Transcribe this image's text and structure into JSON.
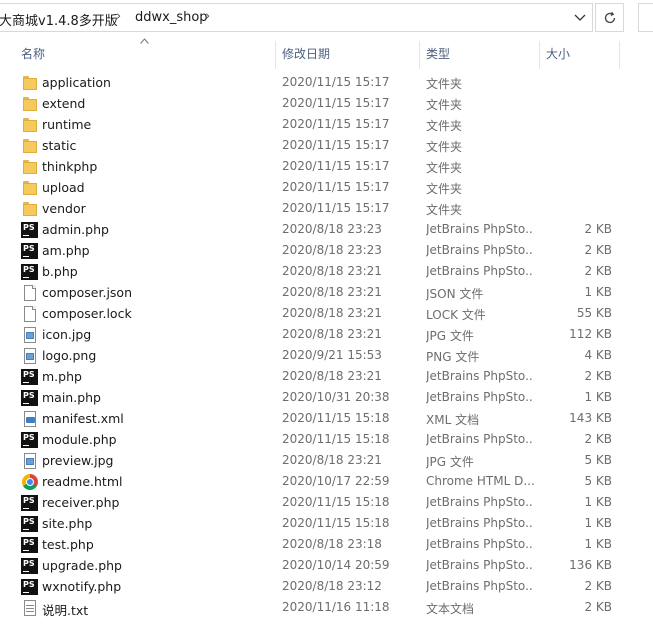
{
  "address_bar": {
    "crumbs": [
      "大商城v1.4.8多开版",
      "ddwx_shop"
    ],
    "separator": "›",
    "dropdown_icon": "chevron-down-icon",
    "refresh_icon": "refresh-icon"
  },
  "columns": {
    "name": "名称",
    "date": "修改日期",
    "type": "类型",
    "size": "大小"
  },
  "files": [
    {
      "name": "application",
      "date": "2020/11/15 15:17",
      "type": "文件夹",
      "size": "",
      "icon": "folder-icon"
    },
    {
      "name": "extend",
      "date": "2020/11/15 15:17",
      "type": "文件夹",
      "size": "",
      "icon": "folder-icon"
    },
    {
      "name": "runtime",
      "date": "2020/11/15 15:17",
      "type": "文件夹",
      "size": "",
      "icon": "folder-icon"
    },
    {
      "name": "static",
      "date": "2020/11/15 15:17",
      "type": "文件夹",
      "size": "",
      "icon": "folder-icon"
    },
    {
      "name": "thinkphp",
      "date": "2020/11/15 15:17",
      "type": "文件夹",
      "size": "",
      "icon": "folder-icon"
    },
    {
      "name": "upload",
      "date": "2020/11/15 15:17",
      "type": "文件夹",
      "size": "",
      "icon": "folder-icon"
    },
    {
      "name": "vendor",
      "date": "2020/11/15 15:17",
      "type": "文件夹",
      "size": "",
      "icon": "folder-icon"
    },
    {
      "name": "admin.php",
      "date": "2020/8/18 23:23",
      "type": "JetBrains PhpSto...",
      "size": "2 KB",
      "icon": "phpstorm-icon"
    },
    {
      "name": "am.php",
      "date": "2020/8/18 23:23",
      "type": "JetBrains PhpSto...",
      "size": "2 KB",
      "icon": "phpstorm-icon"
    },
    {
      "name": "b.php",
      "date": "2020/8/18 23:21",
      "type": "JetBrains PhpSto...",
      "size": "2 KB",
      "icon": "phpstorm-icon"
    },
    {
      "name": "composer.json",
      "date": "2020/8/18 23:21",
      "type": "JSON 文件",
      "size": "1 KB",
      "icon": "document-icon"
    },
    {
      "name": "composer.lock",
      "date": "2020/8/18 23:21",
      "type": "LOCK 文件",
      "size": "55 KB",
      "icon": "document-icon"
    },
    {
      "name": "icon.jpg",
      "date": "2020/8/18 23:21",
      "type": "JPG 文件",
      "size": "112 KB",
      "icon": "image-icon"
    },
    {
      "name": "logo.png",
      "date": "2020/9/21 15:53",
      "type": "PNG 文件",
      "size": "4 KB",
      "icon": "image-icon"
    },
    {
      "name": "m.php",
      "date": "2020/8/18 23:21",
      "type": "JetBrains PhpSto...",
      "size": "2 KB",
      "icon": "phpstorm-icon"
    },
    {
      "name": "main.php",
      "date": "2020/10/31 20:38",
      "type": "JetBrains PhpSto...",
      "size": "1 KB",
      "icon": "phpstorm-icon"
    },
    {
      "name": "manifest.xml",
      "date": "2020/11/15 15:18",
      "type": "XML 文档",
      "size": "143 KB",
      "icon": "xml-icon"
    },
    {
      "name": "module.php",
      "date": "2020/11/15 15:18",
      "type": "JetBrains PhpSto...",
      "size": "2 KB",
      "icon": "phpstorm-icon"
    },
    {
      "name": "preview.jpg",
      "date": "2020/8/18 23:21",
      "type": "JPG 文件",
      "size": "5 KB",
      "icon": "image-icon"
    },
    {
      "name": "readme.html",
      "date": "2020/10/17 22:59",
      "type": "Chrome HTML D...",
      "size": "5 KB",
      "icon": "chrome-icon"
    },
    {
      "name": "receiver.php",
      "date": "2020/11/15 15:18",
      "type": "JetBrains PhpSto...",
      "size": "1 KB",
      "icon": "phpstorm-icon"
    },
    {
      "name": "site.php",
      "date": "2020/11/15 15:18",
      "type": "JetBrains PhpSto...",
      "size": "1 KB",
      "icon": "phpstorm-icon"
    },
    {
      "name": "test.php",
      "date": "2020/8/18 23:18",
      "type": "JetBrains PhpSto...",
      "size": "1 KB",
      "icon": "phpstorm-icon"
    },
    {
      "name": "upgrade.php",
      "date": "2020/10/14 20:59",
      "type": "JetBrains PhpSto...",
      "size": "136 KB",
      "icon": "phpstorm-icon"
    },
    {
      "name": "wxnotify.php",
      "date": "2020/8/18 23:12",
      "type": "JetBrains PhpSto...",
      "size": "2 KB",
      "icon": "phpstorm-icon"
    },
    {
      "name": "说明.txt",
      "date": "2020/11/16 11:18",
      "type": "文本文档",
      "size": "2 KB",
      "icon": "text-file-icon"
    }
  ]
}
